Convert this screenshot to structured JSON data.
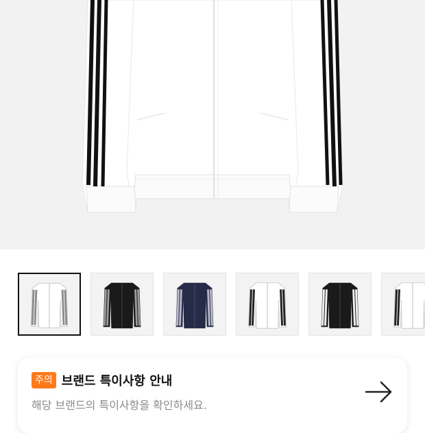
{
  "product_image": {
    "alt_icon": "white-track-jacket-image",
    "colors": {
      "jacket": "#ffffff",
      "stripes": "#111111",
      "background": "#f2f2f2"
    }
  },
  "thumbnails": [
    {
      "icon": "jacket-white-grey-stripes",
      "selected": true,
      "body": "#ffffff",
      "stripe": "#8c8c8c"
    },
    {
      "icon": "jacket-black-grey-stripes",
      "selected": false,
      "body": "#1a1a1a",
      "stripe": "#9a9a9a"
    },
    {
      "icon": "jacket-navy-grey-stripes",
      "selected": false,
      "body": "#262b48",
      "stripe": "#b8b8c8"
    },
    {
      "icon": "jacket-white-black-stripes",
      "selected": false,
      "body": "#ffffff",
      "stripe": "#222222"
    },
    {
      "icon": "jacket-black-white-stripes",
      "selected": false,
      "body": "#1a1a1a",
      "stripe": "#f0f0f0"
    },
    {
      "icon": "jacket-white-black-stripes",
      "selected": false,
      "body": "#ffffff",
      "stripe": "#222222"
    }
  ],
  "notice": {
    "badge": "주의",
    "title": "브랜드 특이사항 안내",
    "description": "해당 브랜드의 특이사항을 확인하세요.",
    "arrow_icon": "arrow-right-icon",
    "badge_color": "#ff7a1a"
  }
}
